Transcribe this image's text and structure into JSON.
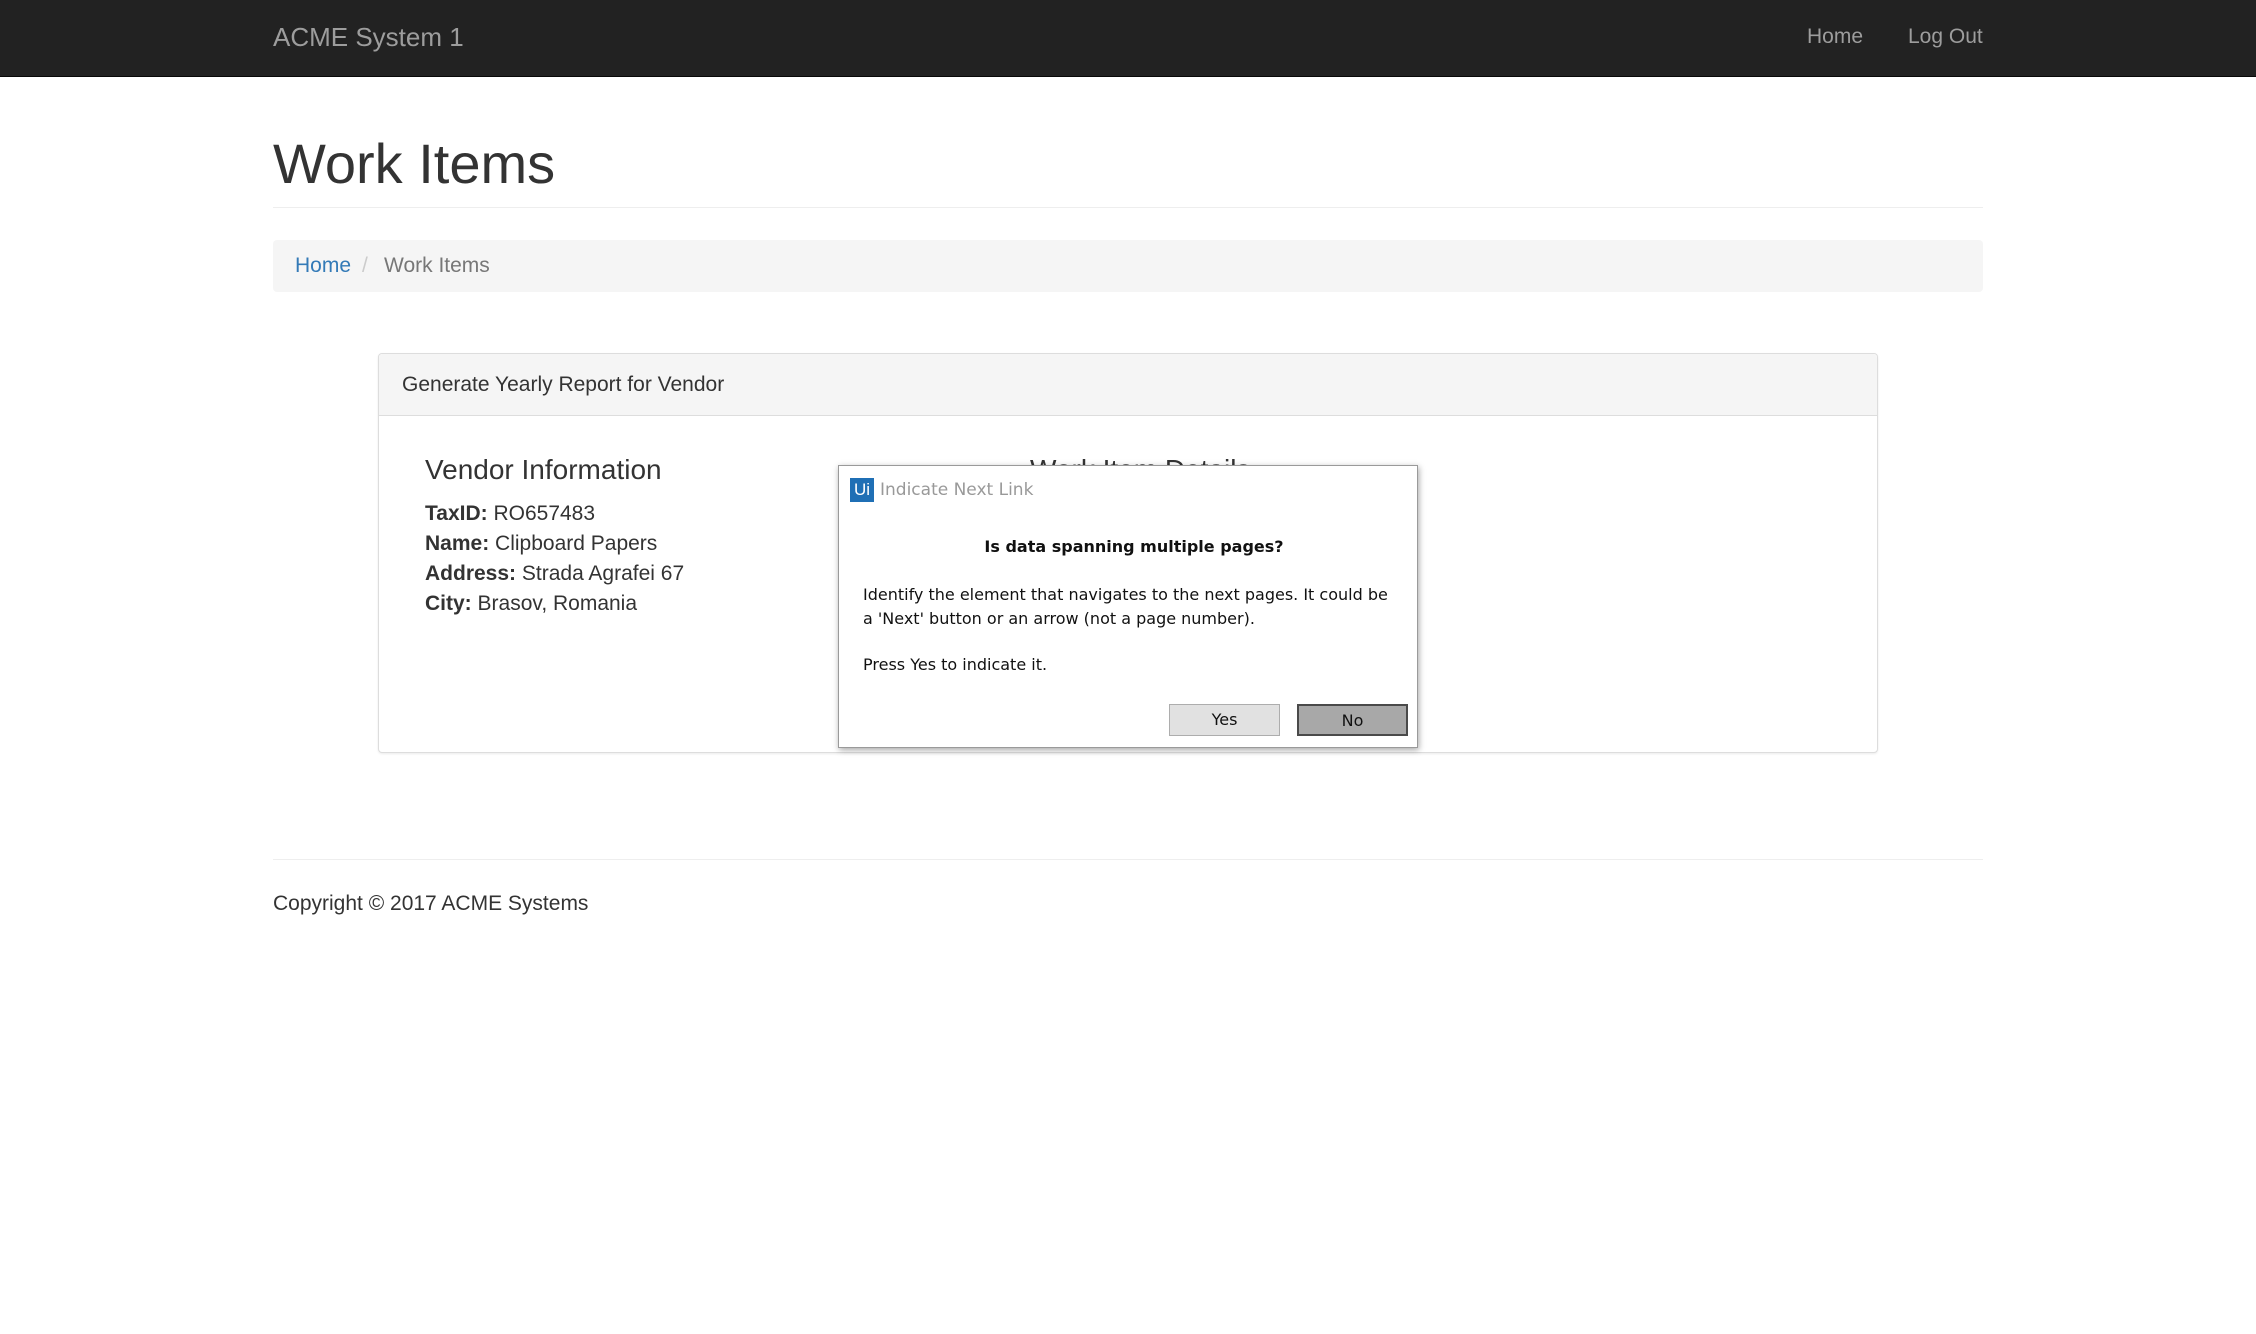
{
  "navbar": {
    "brand": "ACME System 1",
    "links": [
      {
        "label": "Home"
      },
      {
        "label": "Log Out"
      }
    ]
  },
  "page": {
    "title": "Work Items"
  },
  "breadcrumb": {
    "home": "Home",
    "separator": "/",
    "current": "Work Items"
  },
  "panel": {
    "title": "Generate Yearly Report for Vendor",
    "vendor": {
      "heading": "Vendor Information",
      "fields": [
        {
          "label": "TaxID:",
          "value": "RO657483"
        },
        {
          "label": "Name:",
          "value": "Clipboard Papers"
        },
        {
          "label": "Address:",
          "value": "Strada Agrafei 67"
        },
        {
          "label": "City:",
          "value": "Brasov, Romania"
        }
      ]
    },
    "details_heading": "Work Item Details"
  },
  "footer": {
    "text": "Copyright © 2017 ACME Systems"
  },
  "dialog": {
    "logo": "Ui",
    "title": "Indicate Next Link",
    "question": "Is data spanning multiple pages?",
    "body": "Identify the element that navigates to the next pages. It could be a 'Next' button or an arrow (not a page number).",
    "press": "Press Yes to indicate it.",
    "yes_label": "Yes",
    "no_label": "No"
  },
  "colors": {
    "navbar_bg": "#222222",
    "link_blue": "#337ab7",
    "logo_blue": "#1f6fb5"
  }
}
